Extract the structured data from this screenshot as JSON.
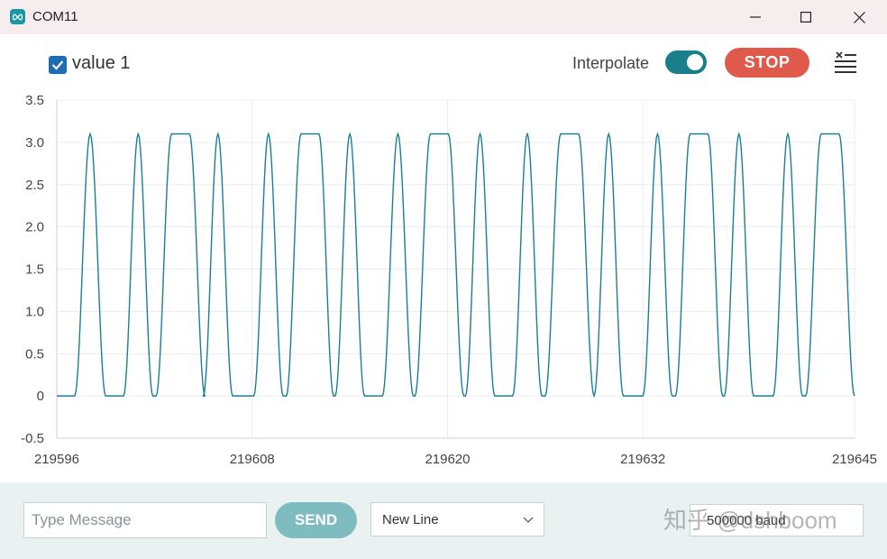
{
  "window": {
    "title": "COM11",
    "icon": "arduino-infinity-icon"
  },
  "toolbar": {
    "legend_label": "value 1",
    "legend_checked": true,
    "interpolate_label": "Interpolate",
    "interpolate_on": true,
    "stop_label": "STOP",
    "clear_icon": "clear-list-icon"
  },
  "colors": {
    "series": "#1a7f95",
    "stop": "#e05a4b",
    "toggle": "#1a7f8a",
    "send": "#7fbcbf",
    "check": "#1d6db5"
  },
  "bottom": {
    "message_placeholder": "Type Message",
    "send_label": "SEND",
    "line_ending": "New Line",
    "baud": "500000 baud",
    "watermark": "知乎 @dshboom"
  },
  "chart_data": {
    "type": "line",
    "ylim": [
      -0.5,
      3.5
    ],
    "yticks": [
      "3.5",
      "3.0",
      "2.5",
      "2.0",
      "1.5",
      "1.0",
      "0.5",
      "0",
      "-0.5"
    ],
    "xlim": [
      219596,
      219645
    ],
    "xticks": [
      "219596",
      "219608",
      "219620",
      "219632",
      "219645"
    ],
    "grid": true,
    "series": [
      {
        "name": "value 1",
        "peak": 3.1,
        "pulses": [
          {
            "start": 219597.1,
            "end": 219599.0,
            "hold": 0
          },
          {
            "start": 219600.1,
            "end": 219601.9,
            "hold": 0
          },
          {
            "start": 219602.1,
            "end": 219605.1,
            "hold": 1.1
          },
          {
            "start": 219605.0,
            "end": 219606.8,
            "hold": 0
          },
          {
            "start": 219608.1,
            "end": 219609.9,
            "hold": 0
          },
          {
            "start": 219610.1,
            "end": 219613.0,
            "hold": 1.1
          },
          {
            "start": 219613.1,
            "end": 219614.9,
            "hold": 0
          },
          {
            "start": 219616.0,
            "end": 219617.9,
            "hold": 0
          },
          {
            "start": 219618.0,
            "end": 219621.0,
            "hold": 1.1
          },
          {
            "start": 219621.1,
            "end": 219622.9,
            "hold": 0
          },
          {
            "start": 219624.0,
            "end": 219625.8,
            "hold": 0
          },
          {
            "start": 219626.0,
            "end": 219629.0,
            "hold": 1.1
          },
          {
            "start": 219629.0,
            "end": 219630.8,
            "hold": 0
          },
          {
            "start": 219632.0,
            "end": 219633.8,
            "hold": 0
          },
          {
            "start": 219634.0,
            "end": 219636.9,
            "hold": 1.1
          },
          {
            "start": 219637.0,
            "end": 219638.8,
            "hold": 0
          },
          {
            "start": 219640.0,
            "end": 219641.8,
            "hold": 0
          },
          {
            "start": 219642.0,
            "end": 219645.0,
            "hold": 1.1
          }
        ]
      }
    ]
  }
}
